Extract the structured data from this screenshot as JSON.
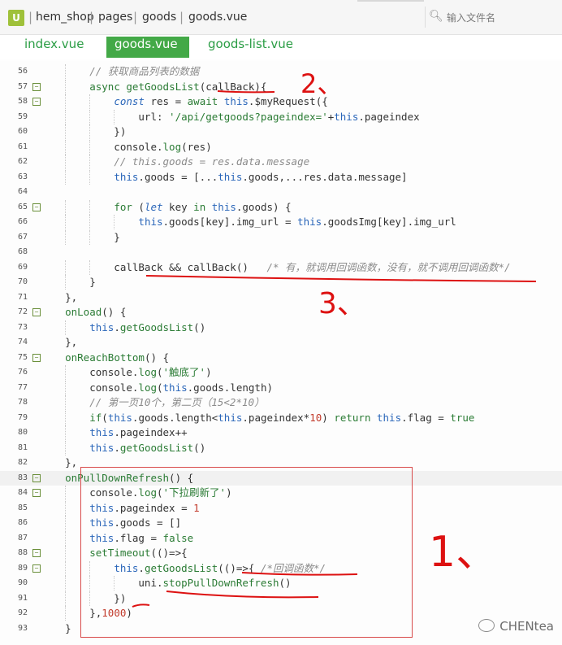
{
  "breadcrumb": {
    "logo": "U",
    "items": [
      "hem_shop",
      "pages",
      "goods",
      "goods.vue"
    ]
  },
  "file_search": {
    "icon": "search-file-icon",
    "placeholder": "输入文件名"
  },
  "tabs": [
    {
      "label": "index.vue",
      "active": false
    },
    {
      "label": "goods.vue",
      "active": true
    },
    {
      "label": "goods-list.vue",
      "active": false
    }
  ],
  "gutter": {
    "line_numbers": [
      "56",
      "57",
      "58",
      "59",
      "60",
      "61",
      "62",
      "63",
      "64",
      "65",
      "66",
      "67",
      "68",
      "69",
      "70",
      "71",
      "72",
      "73",
      "74",
      "75",
      "76",
      "77",
      "78",
      "79",
      "80",
      "81",
      "82",
      "83",
      "84",
      "85",
      "86",
      "87",
      "88",
      "89",
      "90",
      "91",
      "92",
      "93"
    ],
    "fold_markers": [
      "57",
      "58",
      "65",
      "72",
      "75",
      "83",
      "84",
      "88",
      "89"
    ]
  },
  "code_lines": [
    "        // 获取商品列表的数据",
    "        async getGoodsList(callBack){",
    "            const res = await this.$myRequest({",
    "                url: '/api/getgoods?pageindex='+this.pageindex",
    "            })",
    "            console.log(res)",
    "            // this.goods = res.data.message",
    "            this.goods = [...this.goods,...res.data.message]",
    "",
    "            for (let key in this.goods) {",
    "                this.goods[key].img_url = this.goodsImg[key].img_url",
    "            }",
    "",
    "            callBack && callBack()   /* 有，就调用回调函数，没有，就不调用回调函数*/",
    "        }",
    "    },",
    "    onLoad() {",
    "        this.getGoodsList()",
    "    },",
    "    onReachBottom() {",
    "        console.log('触底了')",
    "        console.log(this.goods.length)",
    "        // 第一页10个，第二页（15<2*10）",
    "        if(this.goods.length<this.pageindex*10) return this.flag = true",
    "        this.pageindex++",
    "        this.getGoodsList()",
    "    },",
    "    onPullDownRefresh() {",
    "        console.log('下拉刷新了')",
    "        this.pageindex = 1",
    "        this.goods = []",
    "        this.flag = false",
    "        setTimeout(()=>{",
    "            this.getGoodsList(()=>{ /*回调函数*/",
    "                uni.stopPullDownRefresh()",
    "            })",
    "        },1000)",
    "    }"
  ],
  "annotations": {
    "one": "1、",
    "two": "2、",
    "three": "3、"
  },
  "watermark": {
    "icon": "wechat-icon",
    "text": "CHENtea"
  },
  "colors": {
    "accent": "#43a947",
    "annotation": "#dd1111"
  }
}
